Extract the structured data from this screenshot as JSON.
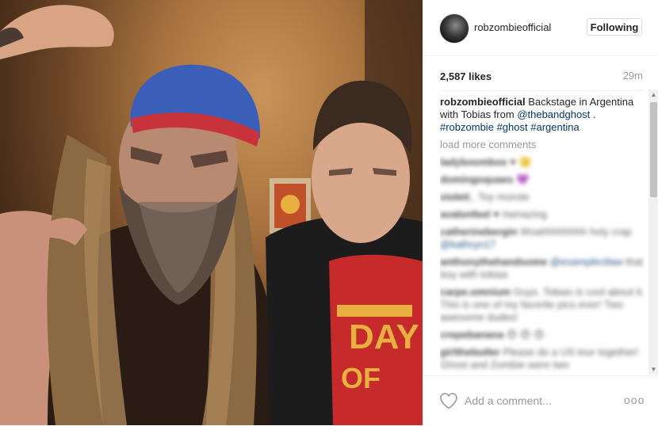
{
  "post": {
    "username": "robzombieofficial",
    "follow_label": "Following",
    "likes": "2,587 likes",
    "time_ago": "29m"
  },
  "caption": {
    "username": "robzombieofficial",
    "text": " Backstage in Argentina with Tobias from ",
    "mention": "@thebandghost",
    "sep": " . ",
    "tags": [
      "#robzombie",
      "#ghost",
      "#argentina"
    ]
  },
  "load_more": "load more comments",
  "comments": [
    {
      "user": "ladyboombox",
      "text": "♥ 🙂"
    },
    {
      "user": "domingoquaes",
      "text": "💜"
    },
    {
      "user": "violeti_",
      "text": "Toy morote"
    },
    {
      "user": "avalonfeel",
      "text": "♥ #amazing"
    },
    {
      "user": "catherinebergin",
      "text": "Woahhhhhhhh holy crap",
      "tag": "@kathryn17"
    },
    {
      "user": "anthonythehandsome",
      "text": "",
      "tag": "@examplectlaw",
      "text2": "that boy with tobias"
    },
    {
      "user": "carpe.omnium",
      "text": "Guys. Tobias is cool about it. This is one of my favorite pics ever! Two awesome dudes!"
    },
    {
      "user": "crepebanana",
      "text": "😍 😍 😍"
    },
    {
      "user": "girlthebutler",
      "text": "Please do a US tour together! Ghost and Zombie were two"
    }
  ],
  "add_comment_placeholder": "Add a comment...",
  "more_options": "ooo",
  "scroll": {
    "up": "▲",
    "down": "▼"
  },
  "icons": {
    "heart": "heart-icon",
    "more": "more-options-icon",
    "avatar": "avatar"
  },
  "colors": {
    "link": "#003569",
    "muted": "#999999",
    "border": "#efefef"
  }
}
